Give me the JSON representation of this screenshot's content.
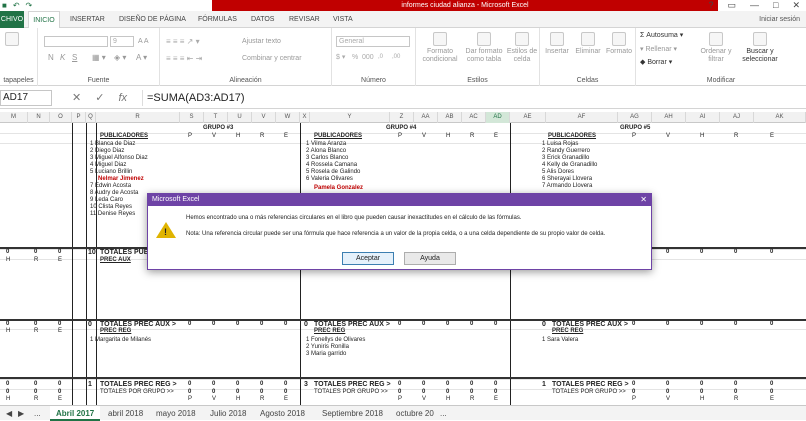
{
  "window": {
    "title": "informes ciudad alianza - Microsoft Excel",
    "signin": "Iniciar sesión",
    "win_buttons": [
      "?",
      "▭",
      "—",
      "□",
      "✕"
    ],
    "qa_icons": [
      "save-icon",
      "undo-icon",
      "redo-icon"
    ]
  },
  "tabs": [
    "CHIVO",
    "INICIO",
    "INSERTAR",
    "DISEÑO DE PÁGINA",
    "FÓRMULAS",
    "DATOS",
    "REVISAR",
    "VISTA"
  ],
  "ribbon": {
    "groups": [
      "tapapeles",
      "Fuente",
      "Alineación",
      "Número",
      "Estilos",
      "Celdas",
      "Modificar"
    ],
    "font_size": "9",
    "font_buttons": [
      "N",
      "K",
      "S"
    ],
    "wrap_text": "Ajustar texto",
    "merge_center": "Combinar y centrar",
    "number_format": "General",
    "number_buttons": [
      "%",
      "000",
      ",0",
      ",00"
    ],
    "styles": [
      "Formato condicional",
      "Dar formato como tabla",
      "Estilos de celda"
    ],
    "cells": [
      "Insertar",
      "Eliminar",
      "Formato"
    ],
    "modify": {
      "autosum": "Autosuma",
      "fill": "Rellenar",
      "clear": "Borrar",
      "sort": "Ordenar y filtrar",
      "find": "Buscar y seleccionar"
    }
  },
  "formula_bar": {
    "name_box": "AD17",
    "formula": "=SUMA(AD3:AD17)",
    "fx": "fx"
  },
  "columns": [
    "M",
    "N",
    "O",
    "P",
    "Q",
    "R",
    "S",
    "T",
    "U",
    "V",
    "W",
    "X",
    "Y",
    "Z",
    "AA",
    "AB",
    "AC",
    "AD",
    "AE",
    "AF",
    "AG",
    "AH",
    "AI",
    "AJ",
    "AK"
  ],
  "grid": {
    "group_titles": [
      "GRUPO #3",
      "GRUPO #4",
      "GRUPO #5"
    ],
    "headers": {
      "pub": "PUBLICADORES",
      "cols": [
        "P",
        "V",
        "H",
        "R",
        "E"
      ]
    },
    "left_hdr": [
      "H",
      "R",
      "E"
    ],
    "group3_names": [
      "1 Blanca de Diaz",
      "2 Diego Diaz",
      "3 Miguel Alfonso Diaz",
      "4 Miguel Diaz",
      "5 Luciano Brillin",
      "Nelmar Jimenez",
      "7 Edwin Acosta",
      "8 Audry de Acosta",
      "9 Leda Caro",
      "10 Clista Reyes",
      "11 Denise Reyes"
    ],
    "group4_names": [
      "1 Vilma Aranza",
      "2 Alona Blanco",
      "3 Carlos Blanco",
      "4 Rossela Camana",
      "5 Rosela de Galindo",
      "6 Valeria Olivares",
      "Pamela Gonzalez"
    ],
    "group5_names": [
      "1 Luisa Rojas",
      "2 Randy Guerrero",
      "3 Erick Granadillo",
      "4 Kelly de Granadillo",
      "5 Alis Dores",
      "6 Sherayai Llovera",
      "7 Armando Llovera"
    ],
    "totals": {
      "t10": "10",
      "totales_pub": "TOTALES PUBLICADORES >",
      "prec_aux": "PREC AUX",
      "totales_prec_aux": "TOTALES PREC AUX >",
      "prec_reg": "PREC REG",
      "totales_prec_reg": "TOTALES PREC REG >",
      "totales_grupo": "TOTALES POR GRUPO >>"
    },
    "aux_g3": "1 Margarita de Milanés",
    "aux_g4": [
      "1 Fonellys de Olivares",
      "2 Yuniris Ronilla",
      "3 Maria garrido"
    ],
    "aux_g5": "1 Sara Valera",
    "zeros": "0",
    "ones": "1",
    "threes": "3"
  },
  "dialog": {
    "title": "Microsoft Excel",
    "close": "✕",
    "message": "Hemos encontrado una o más referencias circulares en el libro que pueden causar inexactitudes en el cálculo de las fórmulas.",
    "note": "Nota: Una referencia circular puede ser una fórmula que hace referencia a un valor de la propia celda, o a una celda dependiente de su propio valor de celda.",
    "accept": "Aceptar",
    "help": "Ayuda"
  },
  "sheets": {
    "nav": [
      "◀",
      "▶",
      "..."
    ],
    "tabs": [
      "Abril 2017",
      "abril 2018",
      "mayo 2018",
      "Julio 2018",
      "Agosto 2018",
      "Septiembre 2018",
      "octubre 20"
    ],
    "more": "..."
  }
}
